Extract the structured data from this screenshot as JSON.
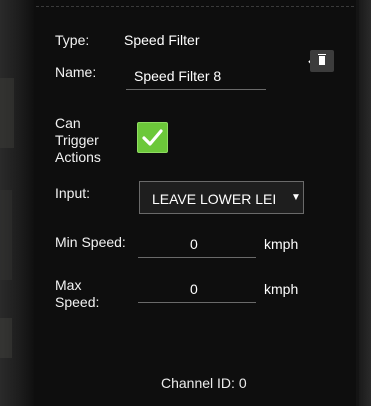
{
  "panel": {
    "type_label": "Type:",
    "type_value": "Speed Filter",
    "name_label": "Name:",
    "name_value": "Speed Filter 8",
    "can_trigger_label_line1": "Can",
    "can_trigger_label_line2": "Trigger",
    "can_trigger_label_line3": "Actions",
    "can_trigger_checked": true,
    "input_label": "Input:",
    "input_selected": "LEAVE LOWER LEI",
    "min_speed_label": "Min Speed:",
    "min_speed_value": "0",
    "min_speed_unit": "kmph",
    "max_speed_label_line1": "Max",
    "max_speed_label_line2": "Speed:",
    "max_speed_value": "0",
    "max_speed_unit": "kmph",
    "channel_id": "Channel ID: 0"
  },
  "icons": {
    "expand": "chevron-down-icon",
    "delete": "trash-icon",
    "check": "checkmark-icon",
    "dropdown": "caret-down-icon"
  },
  "colors": {
    "background": "#0e0e0e",
    "checkbox_fill": "#6cc83a",
    "text": "#ffffff"
  }
}
